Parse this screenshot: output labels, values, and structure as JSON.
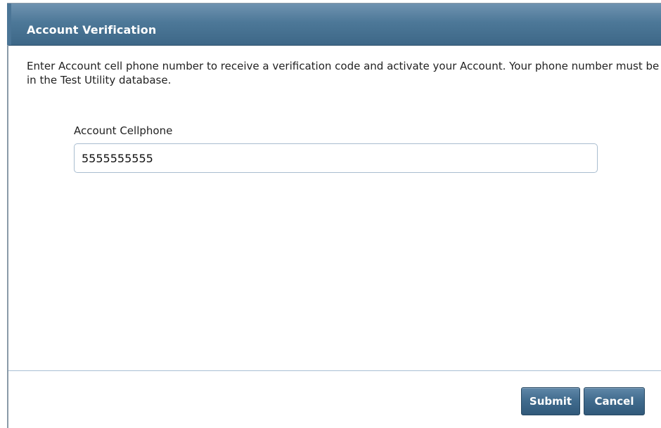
{
  "dialog": {
    "title": "Account Verification",
    "instructions": "Enter Account cell phone number to receive a verification code and activate your Account. Your phone number must be in the Test Utility database.",
    "field": {
      "label": "Account Cellphone",
      "value": "5555555555"
    },
    "buttons": {
      "submit_label": "Submit",
      "cancel_label": "Cancel"
    }
  },
  "colors": {
    "titlebar": "#4d7898",
    "button": "#3f6a8c",
    "divider": "#a9c0d4",
    "input_border": "#a9bdd0"
  }
}
